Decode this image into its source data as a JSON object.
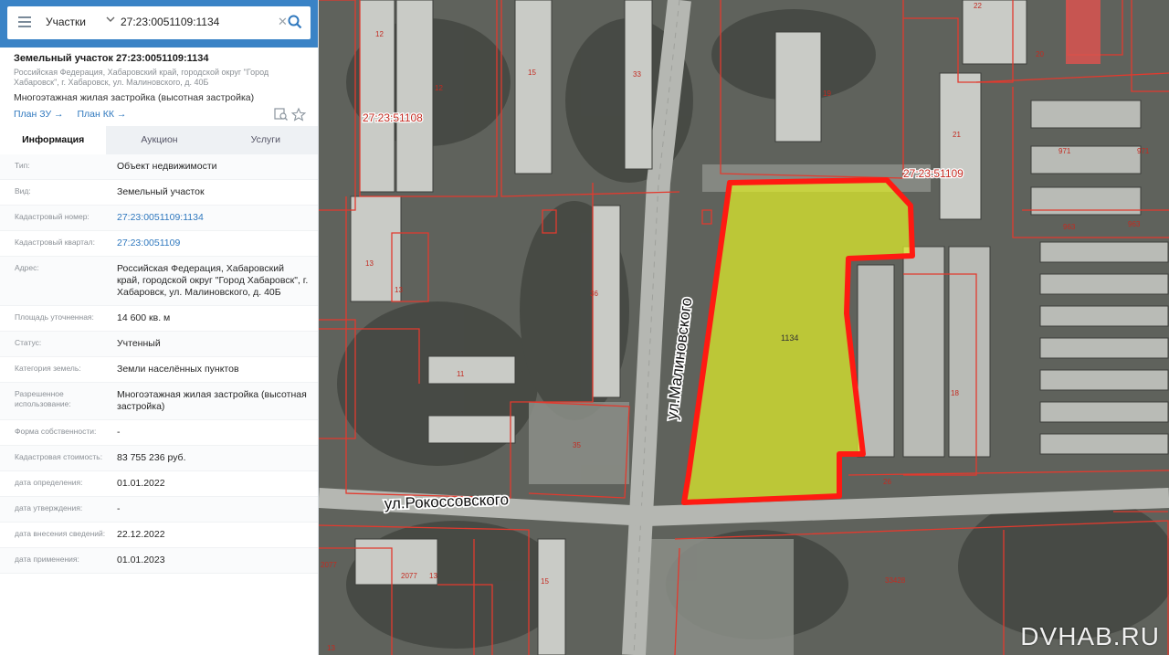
{
  "search": {
    "type_label": "Участки",
    "query": "27:23:0051109:1134"
  },
  "object": {
    "title": "Земельный участок 27:23:0051109:1134",
    "address": "Российская Федерация, Хабаровский край, городской округ \"Город Хабаровск\", г. Хабаровск, ул. Малиновского, д. 40Б",
    "use": "Многоэтажная жилая застройка (высотная застройка)",
    "links": [
      "План ЗУ →",
      "План КК →"
    ]
  },
  "tabs": [
    "Информация",
    "Аукцион",
    "Услуги"
  ],
  "info_rows": [
    {
      "key": "Тип:",
      "value": "Объект недвижимости",
      "link": false
    },
    {
      "key": "Вид:",
      "value": "Земельный участок",
      "link": false
    },
    {
      "key": "Кадастровый номер:",
      "value": "27:23:0051109:1134",
      "link": true
    },
    {
      "key": "Кадастровый квартал:",
      "value": "27:23:0051109",
      "link": true
    },
    {
      "key": "Адрес:",
      "value": "Российская Федерация, Хабаровский край, городской округ \"Город Хабаровск\", г. Хабаровск, ул. Малиновского, д. 40Б",
      "link": false
    },
    {
      "key": "Площадь уточненная:",
      "value": "14 600 кв. м",
      "link": false
    },
    {
      "key": "Статус:",
      "value": "Учтенный",
      "link": false
    },
    {
      "key": "Категория земель:",
      "value": "Земли населённых пунктов",
      "link": false
    },
    {
      "key": "Разрешенное использование:",
      "value": "Многоэтажная жилая застройка (высотная застройка)",
      "link": false
    },
    {
      "key": "Форма собственности:",
      "value": "-",
      "link": false
    },
    {
      "key": "Кадастровая стоимость:",
      "value": "83 755 236 руб.",
      "link": false
    },
    {
      "key": "дата определения:",
      "value": "01.01.2022",
      "link": false
    },
    {
      "key": "дата утверждения:",
      "value": "-",
      "link": false
    },
    {
      "key": "дата внесения сведений:",
      "value": "22.12.2022",
      "link": false
    },
    {
      "key": "дата применения:",
      "value": "01.01.2023",
      "link": false
    }
  ],
  "map": {
    "parcel_label": "1134",
    "street_1": "ул.Малиновского",
    "street_2": "ул.Рокоссовского",
    "quarter_1": "27:23:51108",
    "quarter_2": "27:23:51109",
    "house_numbers": [
      "12",
      "12",
      "15",
      "33",
      "19",
      "22",
      "20",
      "21",
      "971",
      "971",
      "963",
      "963",
      "13",
      "13",
      "36",
      "11",
      "35",
      "18",
      "26",
      "2077",
      "2077",
      "13",
      "15",
      "33428",
      "13"
    ],
    "watermark": "DVHAB.RU",
    "colors": {
      "parcel_fill": "#e0ef2a",
      "parcel_border": "#ff1a12",
      "cadastre_lines": "#e23a2e"
    }
  }
}
